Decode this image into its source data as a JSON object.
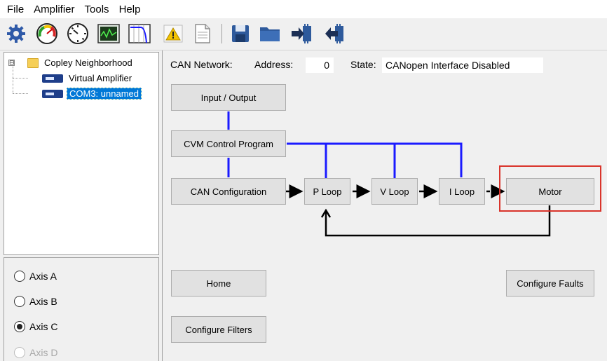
{
  "menu": [
    "File",
    "Amplifier",
    "Tools",
    "Help"
  ],
  "toolbar": {
    "icons": [
      "gear-icon",
      "gauge-icon",
      "dial-icon",
      "scope-icon",
      "filter-plot-icon",
      "warning-icon",
      "document-icon",
      "save-icon",
      "folder-icon",
      "download-icon",
      "upload-icon"
    ]
  },
  "tree": {
    "root_label": "Copley Neighborhood",
    "expander": "⊟",
    "children": [
      "Virtual Amplifier",
      "COM3: unnamed"
    ],
    "selected_index": 1
  },
  "axes": [
    {
      "label": "Axis A",
      "checked": false,
      "enabled": true
    },
    {
      "label": "Axis B",
      "checked": false,
      "enabled": true
    },
    {
      "label": "Axis C",
      "checked": true,
      "enabled": true
    },
    {
      "label": "Axis D",
      "checked": false,
      "enabled": false
    }
  ],
  "status": {
    "can_network_label": "CAN Network:",
    "address_label": "Address:",
    "address_value": "0",
    "state_label": "State:",
    "state_value": "CANopen Interface Disabled"
  },
  "blocks": {
    "input_output": "Input / Output",
    "cvm": "CVM Control Program",
    "can_config": "CAN Configuration",
    "p_loop": "P Loop",
    "v_loop": "V Loop",
    "i_loop": "I Loop",
    "motor": "Motor",
    "home": "Home",
    "configure_faults": "Configure Faults",
    "configure_filters": "Configure Filters"
  },
  "colors": {
    "link_blue": "#1a1aff",
    "flow_black": "#000000",
    "highlight_red": "#d9342b",
    "selection_blue": "#0078d7"
  }
}
